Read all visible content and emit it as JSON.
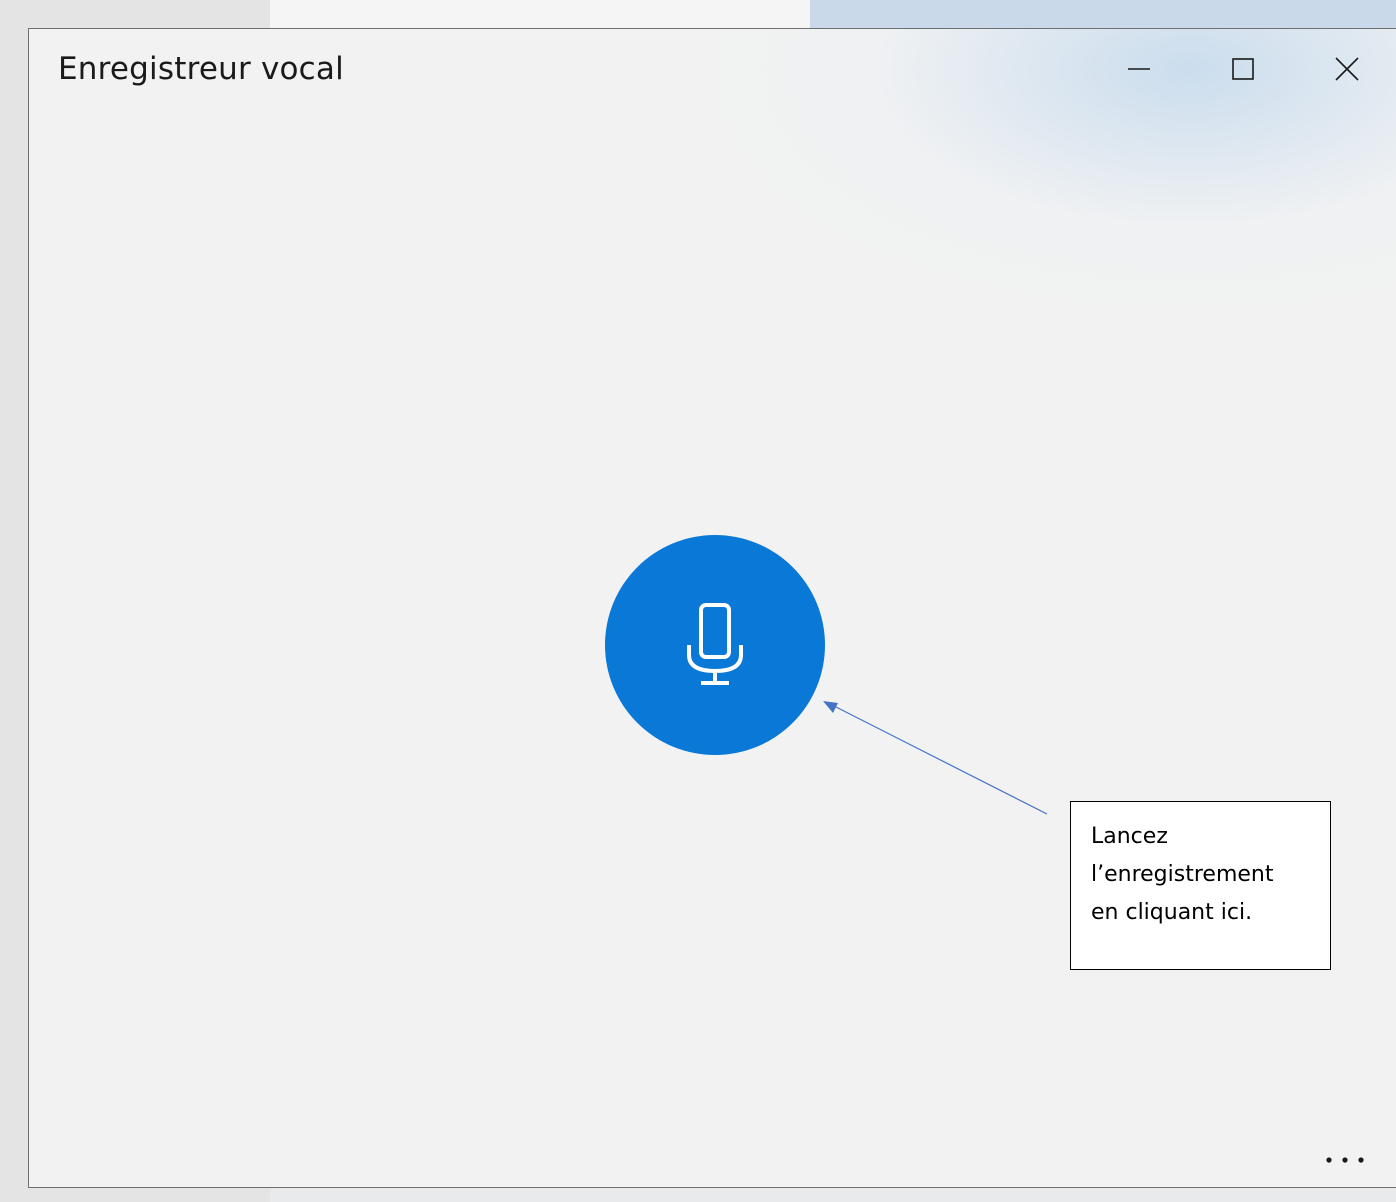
{
  "window": {
    "title": "Enregistreur vocal"
  },
  "titlebar": {
    "icons": [
      "minimize-icon",
      "maximize-icon",
      "close-icon"
    ]
  },
  "record": {
    "icon": "microphone-icon",
    "color": "#0a78d7"
  },
  "footer": {
    "more_icon": "more-options-icon"
  },
  "callout": {
    "lines": [
      "Lancez",
      "l’enregistrement",
      "en cliquant ici."
    ],
    "arrow_color": "#4472c4"
  }
}
